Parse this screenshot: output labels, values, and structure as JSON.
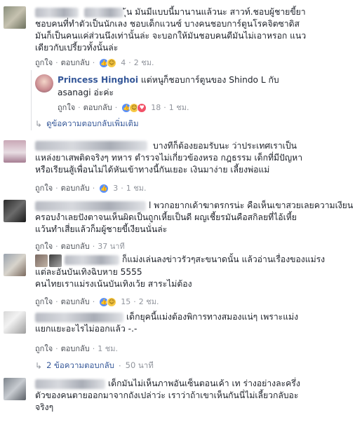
{
  "labels": {
    "like": "ถูกใจ",
    "reply": "ตอบกลับ",
    "sep": "·"
  },
  "comments": [
    {
      "lines": [
        "ุ้น มันมีแบบนี้มานานแล้วนะ สาวท์.ชอบผู้ชายขี้ยา",
        "ชอบคนที่ทำตัวเป็นนักเลง ชอบเด็กแวนซ์ บางคนชอบการ์ตูนโรคจิตซาดิส",
        "มันก็เป็นคนแค่ส่วนนึงเท่านั้นล่ะ จะบอกให้มันชอบคนดีมันไม่เอาหรอก แนว",
        "เดียวกับเปรี้ยวทั้งนั้นล่ะ"
      ],
      "reactions": [
        "like-icon",
        "haha-icon"
      ],
      "count": "4",
      "time": "2 ชม."
    },
    {
      "name": "Princess Hinghoi",
      "lines_first": "แต่หนูก็ชอบการ์ตูนของ Shindo L กับ",
      "lines": [
        "asanagi อ่ะค่ะ"
      ],
      "reactions": [
        "like-icon",
        "haha-icon",
        "love-icon"
      ],
      "count": "18",
      "time": "1 ชม."
    },
    {
      "more_replies": "ดูข้อความตอบกลับเพิ่มเติม"
    },
    {
      "lines": [
        "บางทีก็ต้องยอมรับนะ ว่าประเทศเราเป็น",
        "แหล่งยาเสพติดจริงๆ ทหาร ตำรวจไม่เกี่ยวข้องหรอ กฎธรรม เด็กที่มีปัญหา",
        "หรือเรียนสู้เพื่อนไม่ได้หันเข้าทางนี้กันเยอะ เงินมาง่าย เลี้ยงพ่อแม่"
      ],
      "reactions": [
        "like-icon"
      ],
      "count": "3",
      "time": "1 ชม."
    },
    {
      "lines": [
        "l พวกอยากเด้าฆาตรกรน่ะ คือเห็นเขาสวยเลยความเงียน",
        "ครอบงำเลยปังตาจนเห็นผิดเป็นถูกเหี้ยเป็นดี ผญเชี้ยรมันคือสกิลยที่ไอ้เหี้ย",
        "แว้นทำเสี่ยแล้วก็มผู้ชายขี้เงียนนั่นล่ะ"
      ],
      "reactions": [],
      "count": "",
      "time": "37 นาที"
    },
    {
      "lines": [
        "ก็แม่งเล่นลงข่าวรัวๆสะขนาดนั้น แล้วอ่านเรื่องของแม่รง",
        "แต่ละอันบันเทิงฉิบหาย 5555",
        "คนไทยเราแม่รงเน้นบันเทิงเว้ย สาระไม่ต้อง"
      ],
      "reactions": [
        "like-icon",
        "haha-icon"
      ],
      "count": "15",
      "time": "2 ชม."
    },
    {
      "lines": [
        "เด็กยุคนี้แม่งต้องพิการทางสมองแน่ๆ เพราะแม่ง",
        "แยกแยะอะไรไม่ออกแล้ว -.-"
      ],
      "reactions": [],
      "count": "",
      "time": "1 ชม."
    },
    {
      "more_replies": "2 ข้อความตอบกลับ",
      "time": "50 นาที"
    },
    {
      "lines": [
        "เด็กมันไม่เห็นภาพอันเซ็นตอนเค้า เท ร่างอย่างละครึ่ง",
        "ตัวของคนตายออกมาจากถังเปล่าว่ะ เราว่าถ้าเขาเห็นกันนี่ไม่เลี้ยวกลับอะ",
        "จริงๆ"
      ]
    }
  ]
}
